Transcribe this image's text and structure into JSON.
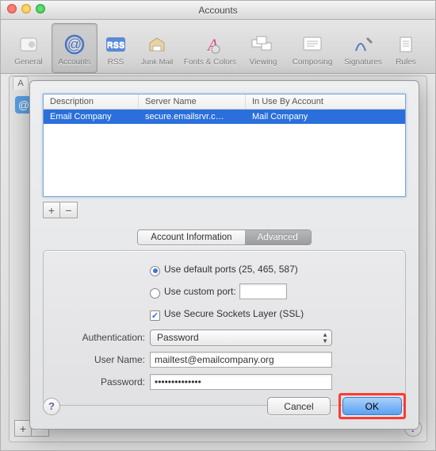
{
  "window": {
    "title": "Accounts"
  },
  "toolbar": {
    "items": [
      {
        "label": "General"
      },
      {
        "label": "Accounts"
      },
      {
        "label": "RSS"
      },
      {
        "label": "Junk Mail"
      },
      {
        "label": "Fonts & Colors"
      },
      {
        "label": "Viewing"
      },
      {
        "label": "Composing"
      },
      {
        "label": "Signatures"
      },
      {
        "label": "Rules"
      }
    ]
  },
  "bg": {
    "left_header": "A",
    "add": "+",
    "remove": "−",
    "help": "?"
  },
  "server_list": {
    "headers": {
      "description": "Description",
      "server": "Server Name",
      "account": "In Use By Account"
    },
    "rows": [
      {
        "description": "Email Company",
        "server": "secure.emailsrvr.c…",
        "account": "Mail Company"
      }
    ],
    "add": "+",
    "remove": "−"
  },
  "tabs": {
    "info": "Account Information",
    "advanced": "Advanced"
  },
  "form": {
    "ports_default": "Use default ports (25, 465, 587)",
    "ports_custom": "Use custom port:",
    "custom_port_value": "",
    "ssl": "Use Secure Sockets Layer (SSL)",
    "auth_label": "Authentication:",
    "auth_value": "Password",
    "user_label": "User Name:",
    "user_value": "mailtest@emailcompany.org",
    "password_label": "Password:",
    "password_value": "••••••••••••••"
  },
  "footer": {
    "help": "?",
    "cancel": "Cancel",
    "ok": "OK"
  }
}
